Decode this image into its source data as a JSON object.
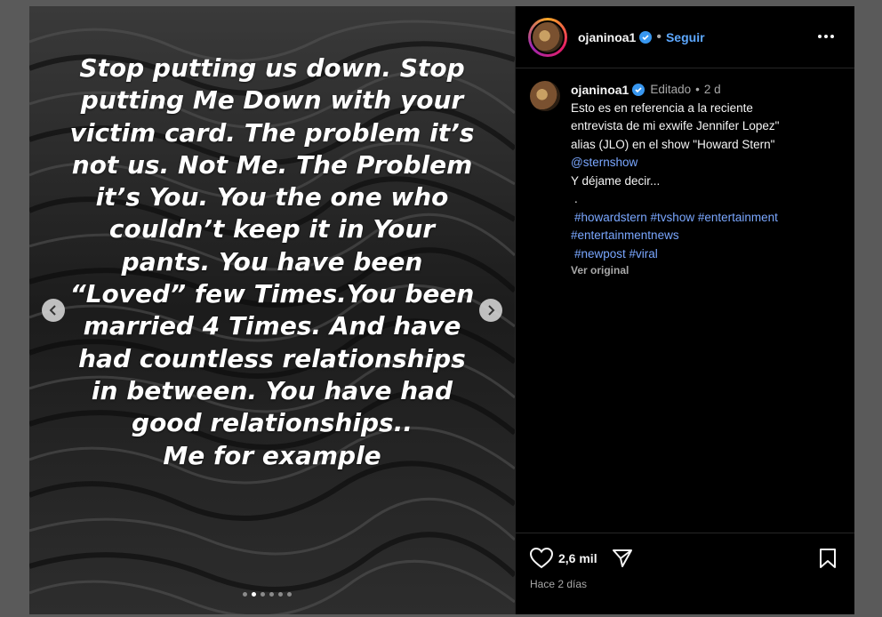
{
  "post": {
    "slide_text": "Stop putting us down. Stop\nputting Me Down with your\nvictim card. The problem it’s\nnot us. Not Me. The Problem\nit’s You. You the one who\ncouldn’t keep it in Your\npants. You have been\n“Loved” few Times.You been\nmarried 4 Times. And have\nhad countless relationships\nin between. You have had\ngood relationships..\nMe for example",
    "carousel": {
      "count": 6,
      "active_index": 1
    }
  },
  "header": {
    "username": "ojaninoa1",
    "separator": "•",
    "follow_label": "Seguir",
    "more_icon": "more-horizontal-icon"
  },
  "caption": {
    "username": "ojaninoa1",
    "edited": "Editado",
    "separator": "•",
    "age": "2 d",
    "lines": [
      "Esto es en referencia a la reciente",
      "entrevista de mi exwife Jennifer Lopez\"",
      "alias (JLO) en el show \"Howard Stern\""
    ],
    "mention": "@sternshow",
    "line_after": "Y déjame decir...",
    "dot_line": ".",
    "hashtags_1": "#howardstern #tvshow #entertainment",
    "hashtags_2": "#entertainmentnews",
    "hashtags_3": "#newpost #viral",
    "see_original": "Ver original"
  },
  "footer": {
    "likes": "2,6 mil",
    "date": "Hace 2 días"
  },
  "colors": {
    "link": "#7aa7ff",
    "follow": "#5da8ff",
    "verified": "#3897f0"
  }
}
